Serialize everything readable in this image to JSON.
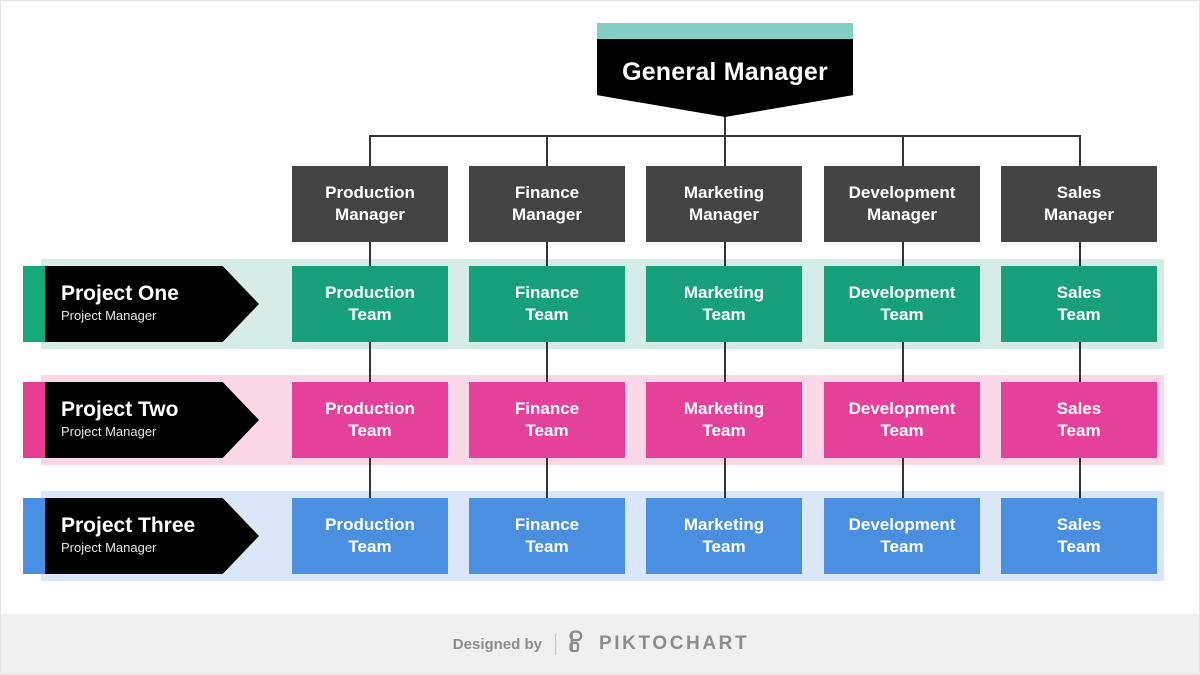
{
  "chart_data": {
    "type": "diagram",
    "diagram_type": "matrix-organizational-chart",
    "title": "General Manager",
    "top_node": {
      "label": "General Manager",
      "accent_color": "#82cdc4",
      "box_color": "#000000",
      "text_color": "#ffffff"
    },
    "functions": [
      "Production",
      "Finance",
      "Marketing",
      "Development",
      "Sales"
    ],
    "manager_row": {
      "box_color": "#444444",
      "text_color": "#ffffff",
      "nodes": [
        {
          "line1": "Production",
          "line2": "Manager"
        },
        {
          "line1": "Finance",
          "line2": "Manager"
        },
        {
          "line1": "Marketing",
          "line2": "Manager"
        },
        {
          "line1": "Development",
          "line2": "Manager"
        },
        {
          "line1": "Sales",
          "line2": "Manager"
        }
      ]
    },
    "project_rows": [
      {
        "title": "Project One",
        "subtitle": "Project Manager",
        "accent_color": "#17a97c",
        "band_color": "#d5ece7",
        "box_color": "#17a07a",
        "teams": [
          {
            "line1": "Production",
            "line2": "Team"
          },
          {
            "line1": "Finance",
            "line2": "Team"
          },
          {
            "line1": "Marketing",
            "line2": "Team"
          },
          {
            "line1": "Development",
            "line2": "Team"
          },
          {
            "line1": "Sales",
            "line2": "Team"
          }
        ]
      },
      {
        "title": "Project Two",
        "subtitle": "Project Manager",
        "accent_color": "#e93d93",
        "band_color": "#fbd8e8",
        "box_color": "#e5409a",
        "teams": [
          {
            "line1": "Production",
            "line2": "Team"
          },
          {
            "line1": "Finance",
            "line2": "Team"
          },
          {
            "line1": "Marketing",
            "line2": "Team"
          },
          {
            "line1": "Development",
            "line2": "Team"
          },
          {
            "line1": "Sales",
            "line2": "Team"
          }
        ]
      },
      {
        "title": "Project Three",
        "subtitle": "Project Manager",
        "accent_color": "#4a90e2",
        "band_color": "#dae7f8",
        "box_color": "#4a8fe0",
        "teams": [
          {
            "line1": "Production",
            "line2": "Team"
          },
          {
            "line1": "Finance",
            "line2": "Team"
          },
          {
            "line1": "Marketing",
            "line2": "Team"
          },
          {
            "line1": "Development",
            "line2": "Team"
          },
          {
            "line1": "Sales",
            "line2": "Team"
          }
        ]
      }
    ],
    "connector_color": "#333333"
  },
  "footer": {
    "designed_by": "Designed by",
    "brand": "PIKTOCHART",
    "logo_icon": "piktochart-logo-icon",
    "text_color": "#8c8c8c",
    "background": "#f0f0f0"
  }
}
